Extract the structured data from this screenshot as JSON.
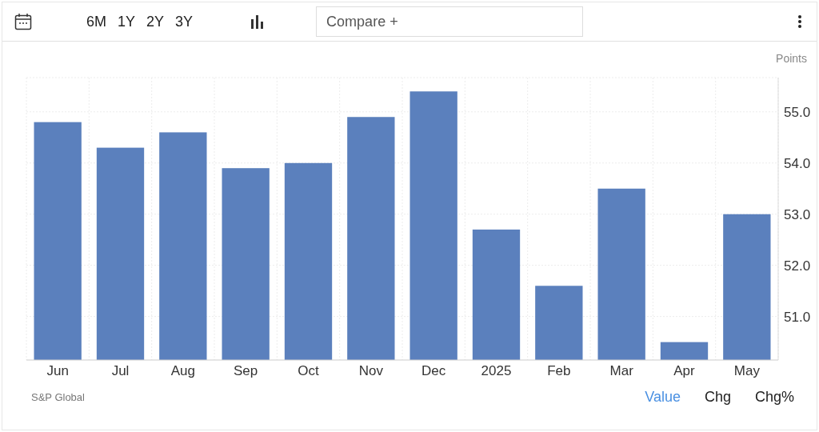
{
  "toolbar": {
    "ranges": [
      "6M",
      "1Y",
      "2Y",
      "3Y"
    ],
    "compare": {
      "placeholder": "Compare +"
    }
  },
  "chart": {
    "unit": "Points",
    "chart_data": {
      "type": "bar",
      "categories": [
        "Jun",
        "Jul",
        "Aug",
        "Sep",
        "Oct",
        "Nov",
        "Dec",
        "2025",
        "Feb",
        "Mar",
        "Apr",
        "May"
      ],
      "grid": true,
      "series": [
        {
          "color": "#5b80bd",
          "values": [
            54.8,
            54.3,
            54.6,
            53.9,
            54.0,
            54.9,
            55.4,
            52.7,
            51.6,
            53.5,
            50.5,
            53.0
          ]
        }
      ],
      "ylim": [
        50.15,
        55.67
      ],
      "yticks": [
        {
          "value": 51,
          "label": "51.0"
        },
        {
          "value": 52,
          "label": "52.0"
        },
        {
          "value": 53,
          "label": "53.0"
        },
        {
          "value": 54,
          "label": "54.0"
        },
        {
          "value": 55,
          "label": "55.0"
        }
      ]
    }
  },
  "footer": {
    "source": "S&P Global",
    "views": [
      {
        "label": "Value",
        "selected": true
      },
      {
        "label": "Chg",
        "selected": false
      },
      {
        "label": "Chg%",
        "selected": false
      }
    ]
  }
}
